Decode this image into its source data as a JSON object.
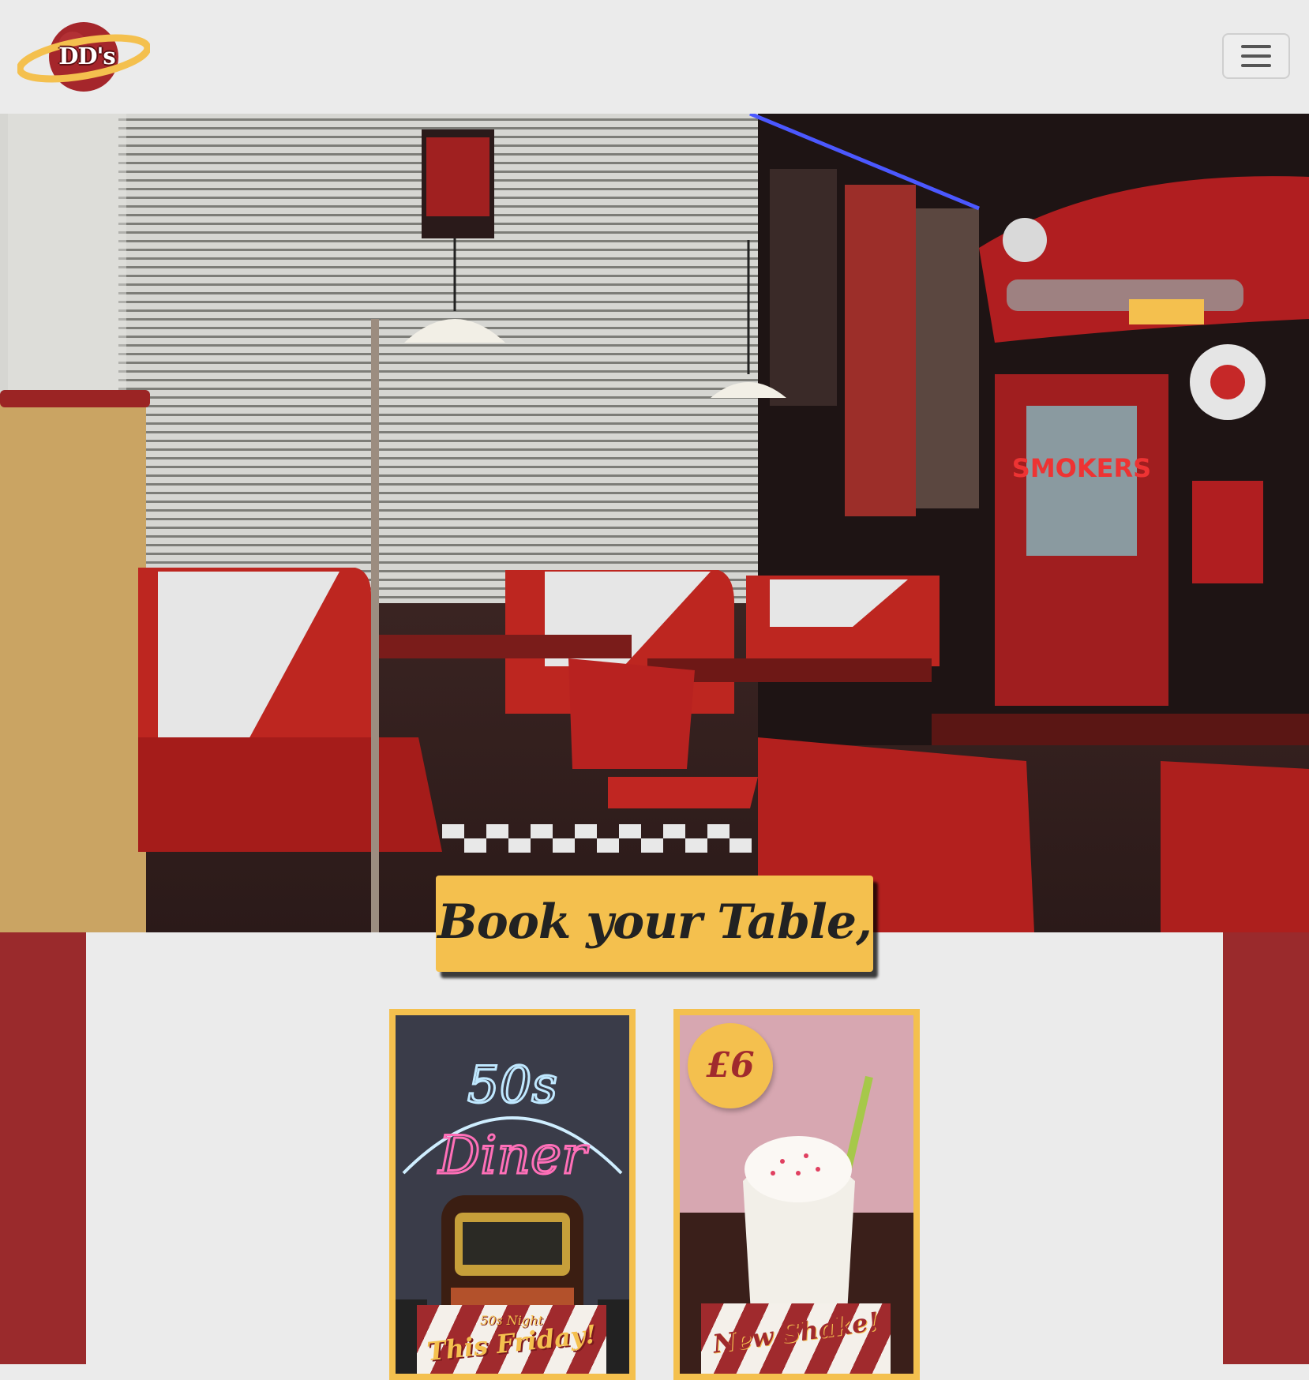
{
  "brand": {
    "logo_text": "DD's",
    "logo_colors": {
      "planet": "#a5262b",
      "ring": "#f4c04e"
    }
  },
  "nav": {
    "toggle_icon": "hamburger-menu-icon"
  },
  "hero": {
    "image_description_icon": "retro-diner-photo"
  },
  "cta": {
    "book_label": "Book your Table,"
  },
  "promos": [
    {
      "banner_small": "50s Night",
      "banner_big": "This Friday!",
      "sign_top": "50s",
      "sign_main": "Diner"
    },
    {
      "price": "£6",
      "banner_big": "New Shake!"
    }
  ],
  "colors": {
    "accent_yellow": "#f4c04e",
    "accent_red": "#9a2a2c",
    "background": "#ebebeb"
  }
}
